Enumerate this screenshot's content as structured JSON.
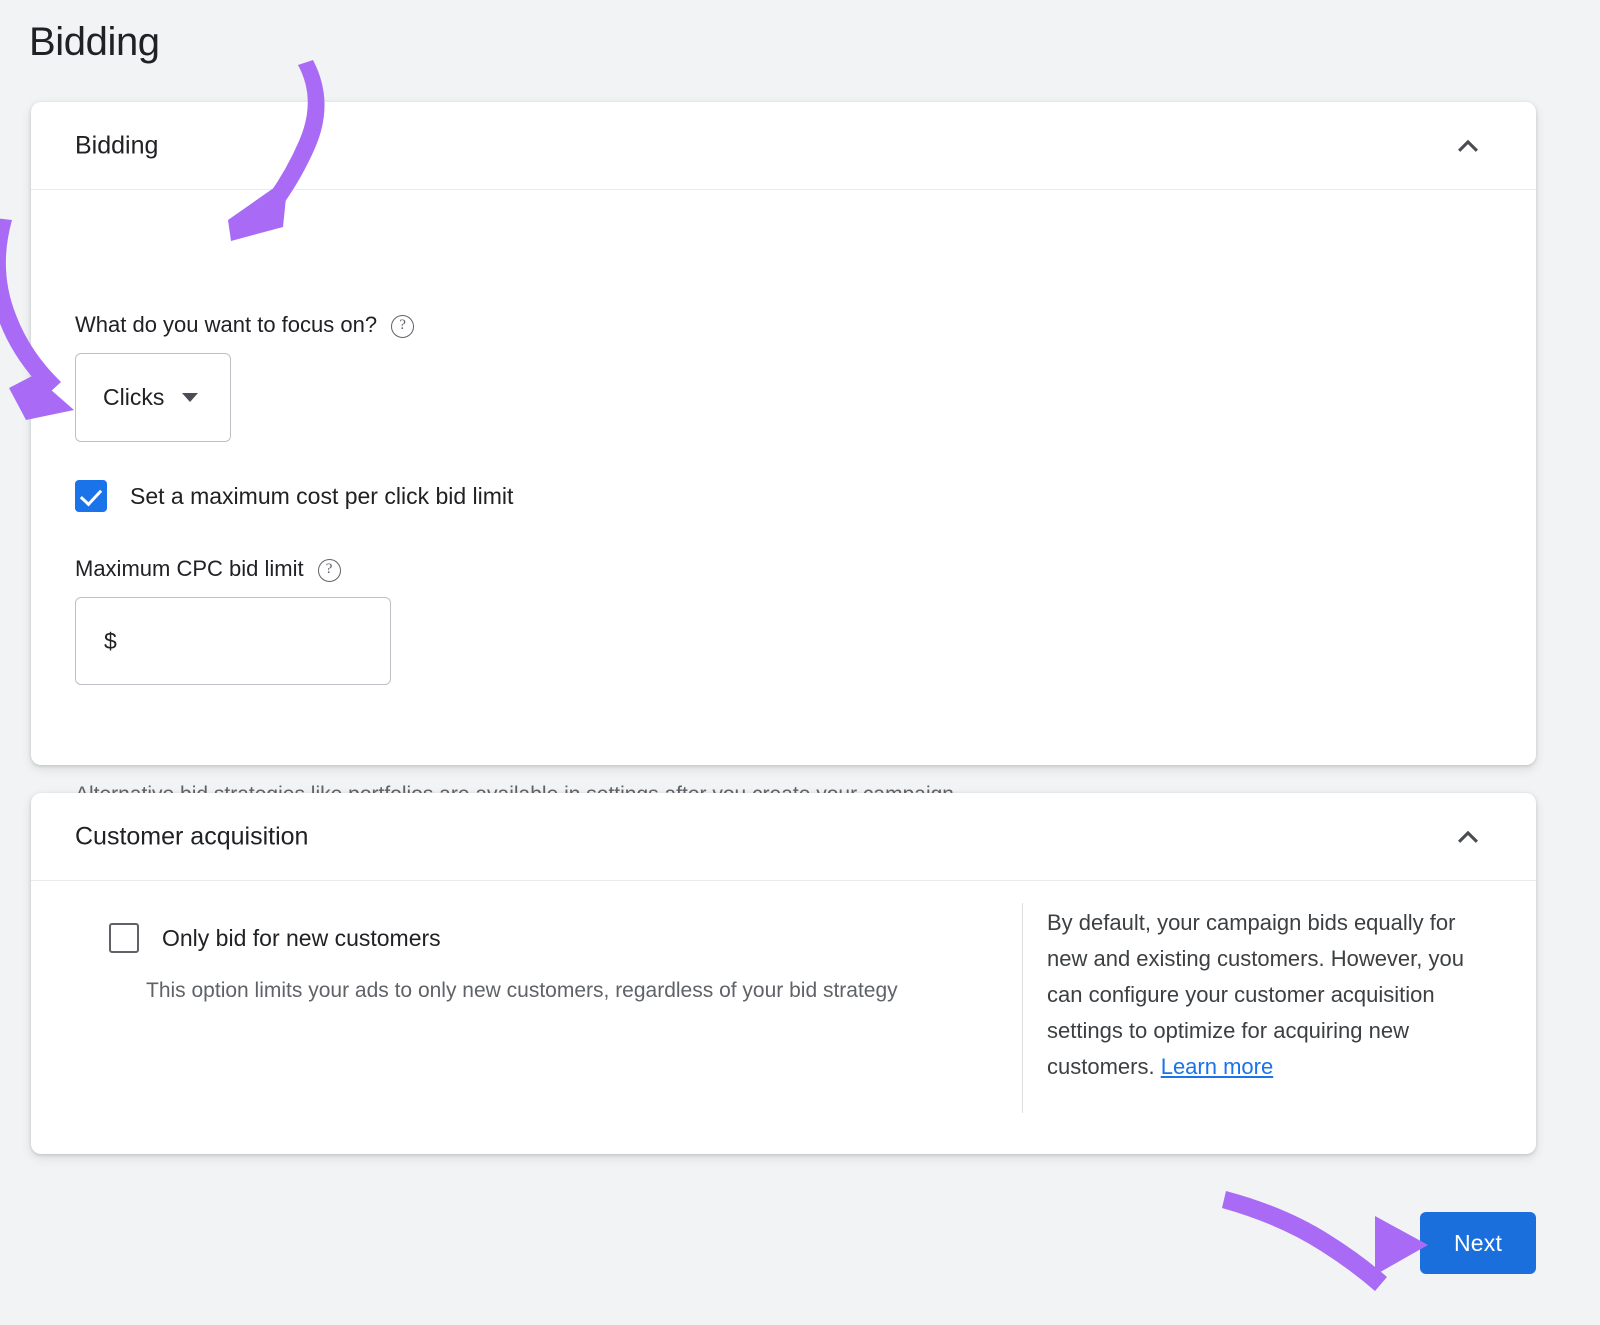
{
  "page": {
    "title": "Bidding",
    "background_color": "#f1f3f4",
    "accent_color": "#1a73e8",
    "annotation_color": "#a96bf5"
  },
  "bidding_card": {
    "header_title": "Bidding",
    "collapse_icon": "chevron-up-icon",
    "focus_question": {
      "label": "What do you want to focus on?",
      "help_icon": "help-circle-icon"
    },
    "focus_select": {
      "value": "Clicks",
      "caret_icon": "caret-down-icon"
    },
    "max_cpc_checkbox": {
      "label": "Set a maximum cost per click bid limit",
      "checked": true
    },
    "max_cpc_field": {
      "label": "Maximum CPC bid limit",
      "help_icon": "help-circle-icon",
      "value": "",
      "placeholder": "$"
    },
    "footnote": "Alternative bid strategies like portfolios are available in settings after you create your campaign"
  },
  "acquisition_card": {
    "header_title": "Customer acquisition",
    "collapse_icon": "chevron-up-icon",
    "new_customers_checkbox": {
      "label": "Only bid for new customers",
      "checked": false
    },
    "new_customers_sub": "This option limits your ads to only new customers, regardless of your bid strategy",
    "description": "By default, your campaign bids equally for new and existing customers. However, you can configure your customer acquisition settings to optimize for acquiring new customers. ",
    "learn_more_label": "Learn more"
  },
  "footer": {
    "next_label": "Next"
  }
}
